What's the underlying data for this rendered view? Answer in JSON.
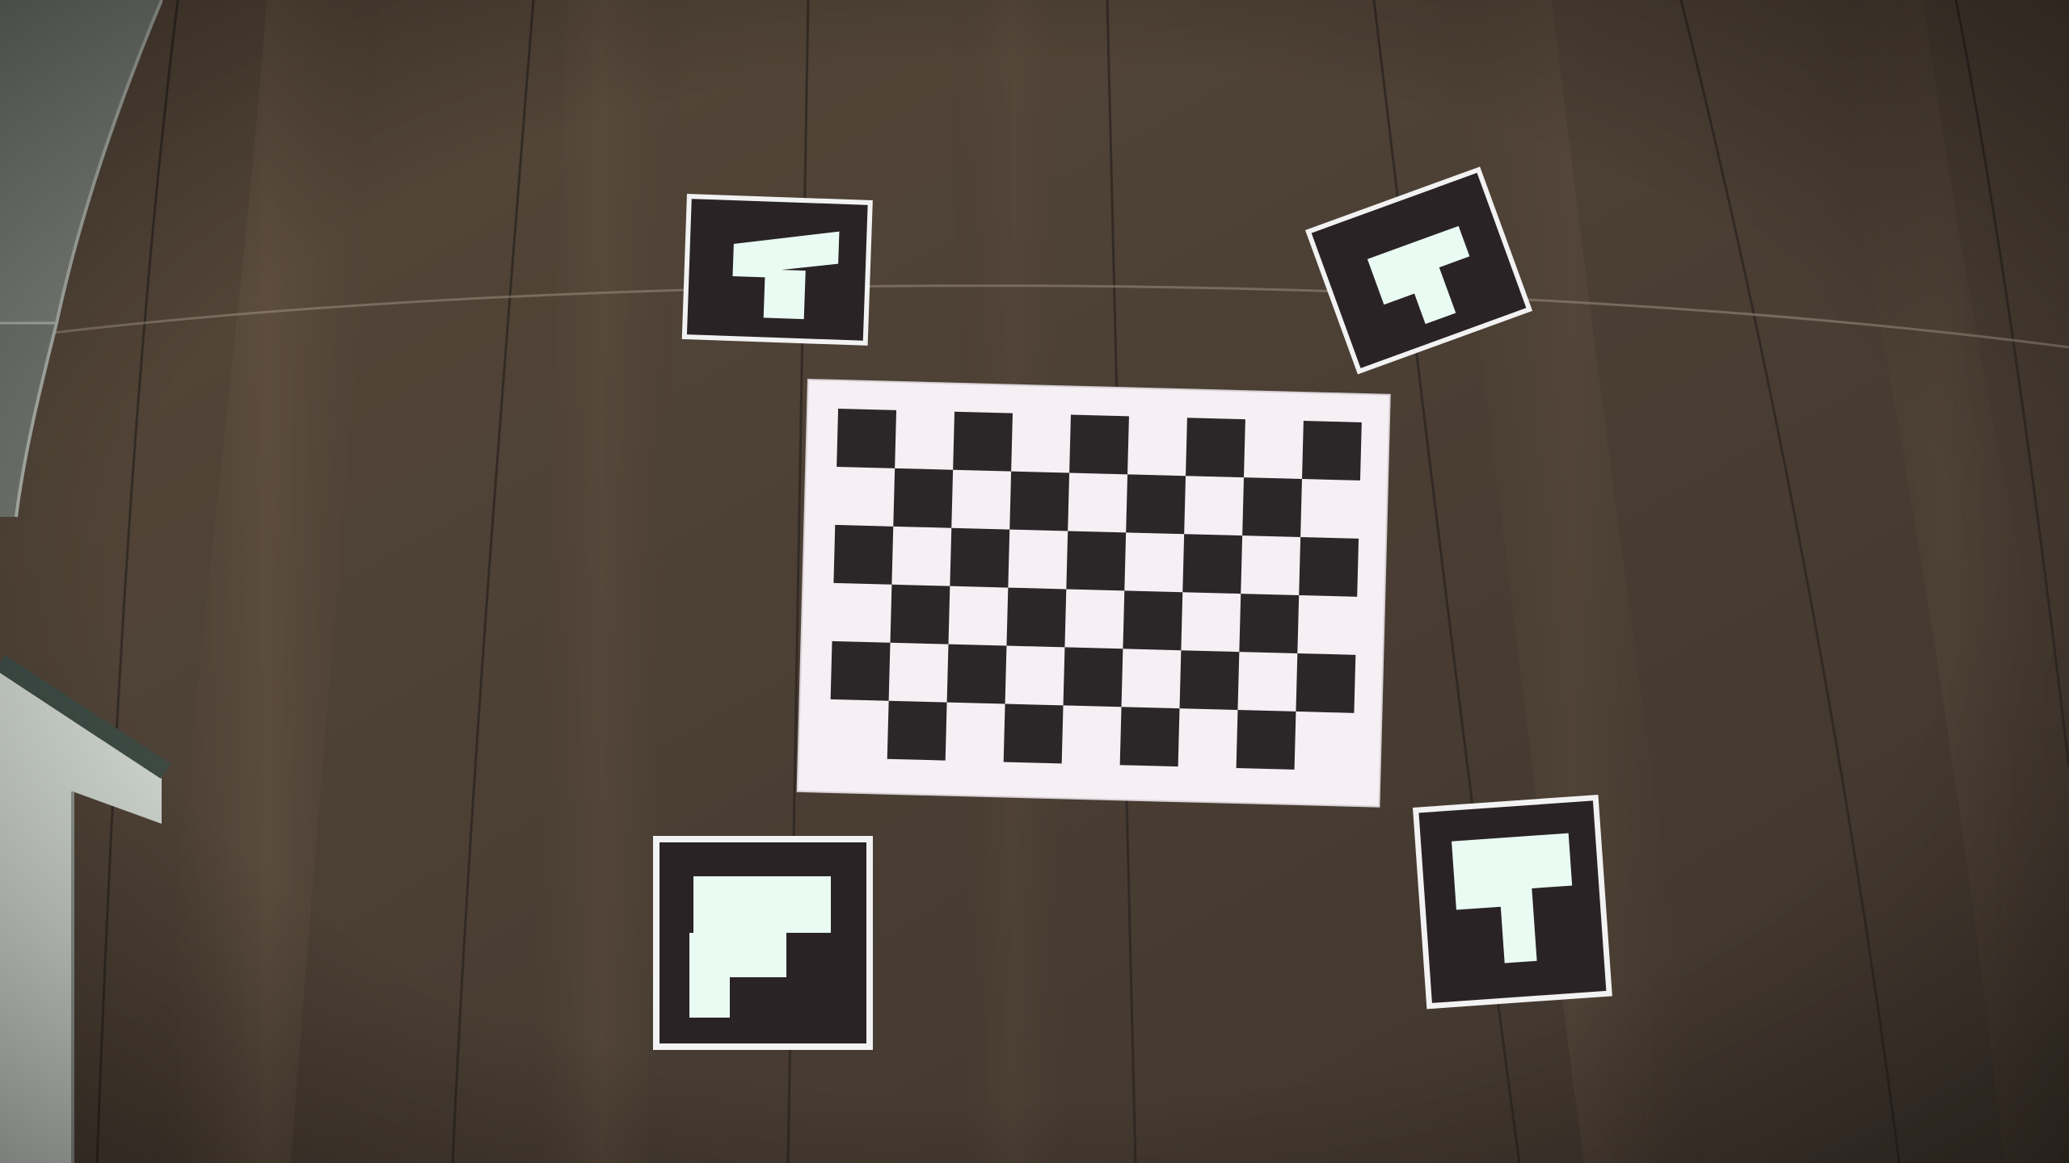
{
  "scene": {
    "description_type": "photo",
    "floor_color": "#4b3f34",
    "floor_dark": "#3a3029",
    "floor_light": "#665647",
    "tile_color": "#7d827c",
    "wall_color": "#c9cfc9"
  },
  "checkerboard": {
    "rows": 6,
    "cols": 9,
    "dark_color": "#2b2729",
    "light_color": "#f3eef2",
    "paper_color": "#f6f0f4"
  },
  "markers": {
    "count": 4,
    "background_color": "#2a2325",
    "glyph_color": "#e9fbf3",
    "border_color": "#f2f2f2",
    "glyph": "F"
  }
}
